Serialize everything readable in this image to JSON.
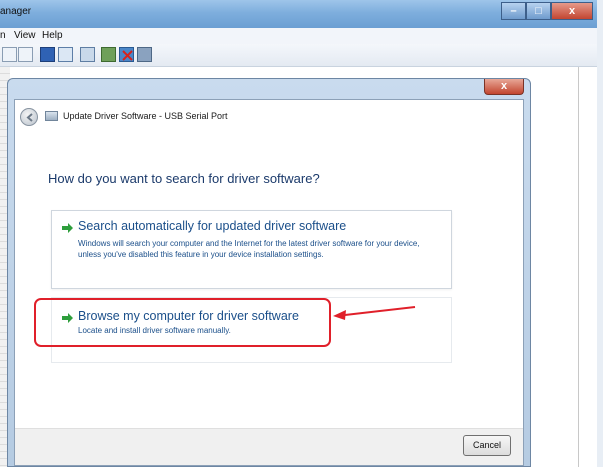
{
  "background_window": {
    "title": "anager",
    "menu": [
      "n",
      "View",
      "Help"
    ],
    "toolbar_icons": [
      "back-icon",
      "forward-icon",
      "properties-icon",
      "help-icon",
      "scan-hardware-icon",
      "update-driver-icon",
      "uninstall-icon",
      "disable-icon"
    ]
  },
  "dialog": {
    "title": "Update Driver Software - USB Serial Port",
    "close_label": "x",
    "question": "How do you want to search for driver software?",
    "options": [
      {
        "title": "Search automatically for updated driver software",
        "description": "Windows will search your computer and the Internet for the latest driver software for your device, unless you've disabled this feature in your device installation settings."
      },
      {
        "title": "Browse my computer for driver software",
        "description": "Locate and install driver software manually."
      }
    ],
    "cancel_label": "Cancel"
  },
  "colors": {
    "accent_green": "#2e9e3c",
    "highlight_red": "#e0202a",
    "link_blue": "#1b4f8a"
  }
}
